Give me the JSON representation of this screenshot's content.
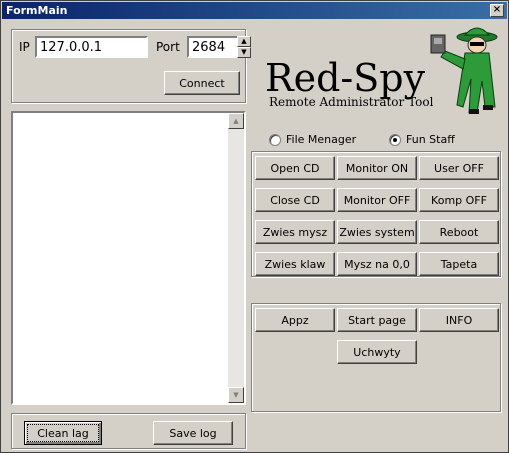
{
  "window": {
    "title": "FormMain",
    "close_glyph": "×"
  },
  "connection": {
    "ip_label": "IP",
    "ip_value": "127.0.0.1",
    "port_label": "Port",
    "port_value": "2684",
    "connect_label": "Connect"
  },
  "logo": {
    "title": "Red-Spy",
    "subtitle": "Remote Administrator Tool",
    "icon": "spy-figure-icon"
  },
  "mode": {
    "options": [
      {
        "label": "File Menager",
        "selected": false
      },
      {
        "label": "Fun Staff",
        "selected": true
      }
    ]
  },
  "fun_buttons": [
    [
      "Open CD",
      "Monitor ON",
      "User OFF"
    ],
    [
      "Close CD",
      "Monitor OFF",
      "Komp OFF"
    ],
    [
      "Zwies mysz",
      "Zwies system",
      "Reboot"
    ],
    [
      "Zwies klaw",
      "Mysz na 0,0",
      "Tapeta"
    ]
  ],
  "extra_buttons": {
    "appz": "Appz",
    "start_page": "Start page",
    "info": "INFO",
    "uchwyty": "Uchwyty"
  },
  "log": {
    "clean_label": "Clean lag",
    "save_label": "Save log"
  },
  "colors": {
    "titlebar": "#0a246a",
    "face": "#d4d0c8",
    "spy_green": "#2e9b3a"
  }
}
